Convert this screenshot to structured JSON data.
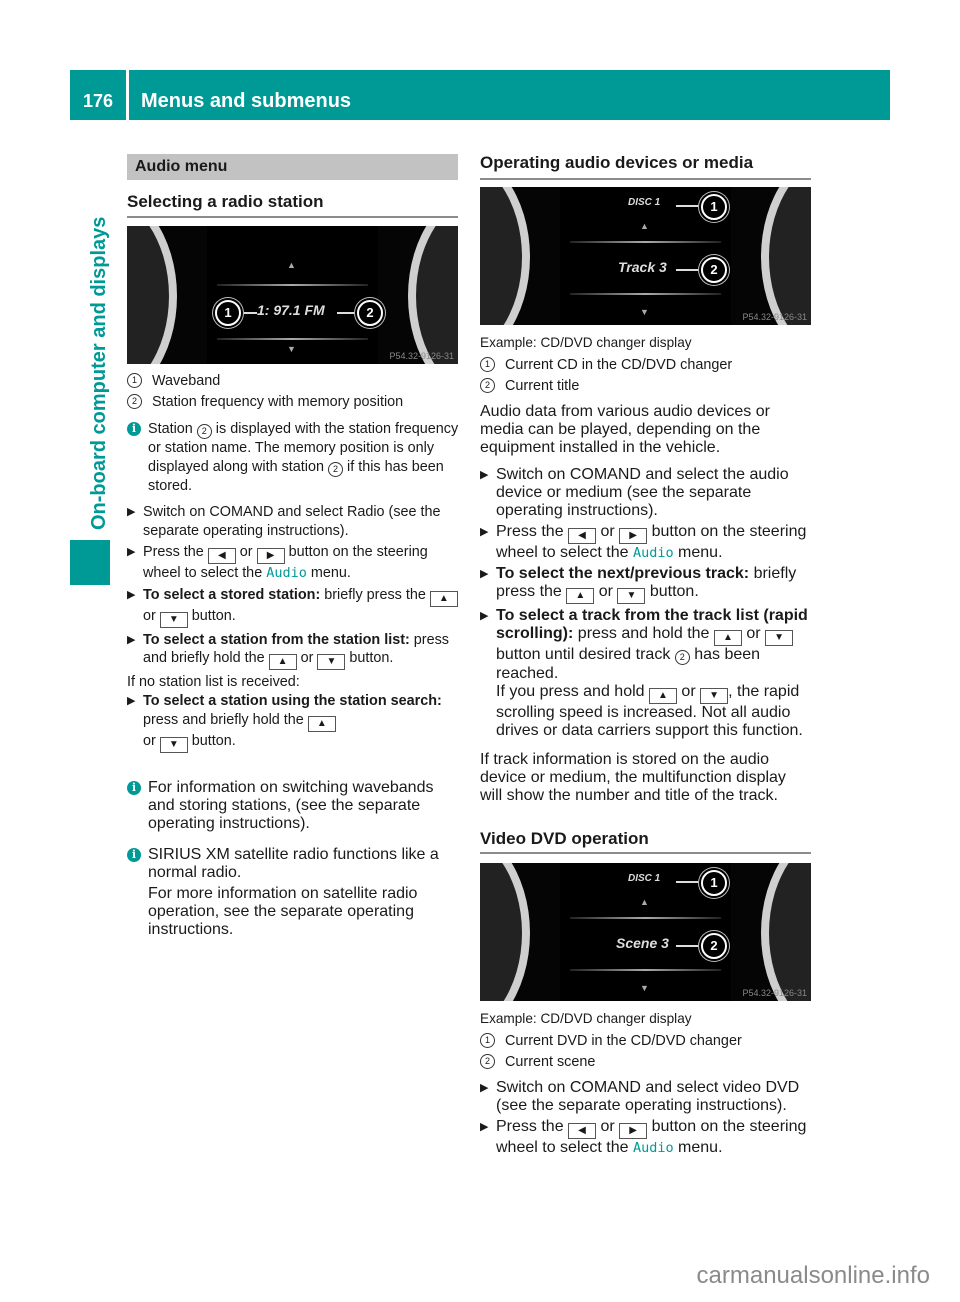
{
  "header": {
    "page_number": "176",
    "title": "Menus and submenus",
    "side_tab": "On-board computer and displays",
    "accent_color": "#009a96"
  },
  "left": {
    "section_bar": "Audio menu",
    "heading": "Selecting a radio station",
    "figure": {
      "display_text": "1: 97.1 FM",
      "callout_1": "1",
      "callout_2": "2",
      "image_code": "P54.32-9126-31"
    },
    "legend": [
      {
        "num": "1",
        "text": "Waveband"
      },
      {
        "num": "2",
        "text": "Station frequency with memory position"
      }
    ],
    "info1": {
      "pre": "Station ",
      "num": "2",
      "mid": " is displayed with the station frequency or station name. The memory position is only displayed along with station ",
      "num2": "2",
      "post": " if this has been stored."
    },
    "steps": [
      {
        "text": "Switch on COMAND and select Radio (see the separate operating instructions)."
      },
      {
        "pre": "Press the ",
        "key1": "◀",
        "or": " or ",
        "key2": "▶",
        "mid": " button on the steering wheel to select the ",
        "code": "Audio",
        "post": " menu."
      },
      {
        "bold": "To select a stored station:",
        "pre": " briefly press the ",
        "key1": "▲",
        "or": " or ",
        "key2": "▼",
        "post": " button."
      },
      {
        "bold": "To select a station from the station list:",
        "pre": " press and briefly hold the ",
        "key1": "▲",
        "or": " or ",
        "key2": "▼",
        "post": " button."
      }
    ],
    "no_list_text": "If no station list is received:",
    "search_step": {
      "bold": "To select a station using the station search:",
      "pre": " press and briefly hold the ",
      "key1": "▲",
      "or": " or ",
      "key2": "▼",
      "post": " button."
    },
    "info2": "For information on switching wavebands and storing stations, (see the separate operating instructions).",
    "info3": "SIRIUS XM satellite radio functions like a normal radio.",
    "info3_more": "For more information on satellite radio operation, see the separate operating instructions."
  },
  "right": {
    "heading1": "Operating audio devices or media",
    "figure1": {
      "line1": "DISC 1",
      "line2": "Track 3",
      "callout_1": "1",
      "callout_2": "2",
      "image_code": "P54.32-9126-31"
    },
    "caption1": "Example: CD/DVD changer display",
    "legend1": [
      {
        "num": "1",
        "text": "Current CD in the CD/DVD changer"
      },
      {
        "num": "2",
        "text": "Current title"
      }
    ],
    "para1": "Audio data from various audio devices or media can be played, depending on the equipment installed in the vehicle.",
    "steps1": [
      {
        "text": "Switch on COMAND and select the audio device or medium (see the separate operating instructions)."
      },
      {
        "pre": "Press the ",
        "key1": "◀",
        "or": " or ",
        "key2": "▶",
        "mid": " button on the steering wheel to select the ",
        "code": "Audio",
        "post": " menu."
      },
      {
        "bold": "To select the next/previous track:",
        "pre": " briefly press the ",
        "key1": "▲",
        "or": " or ",
        "key2": "▼",
        "post": " button."
      },
      {
        "bold": "To select a track from the track list (rapid scrolling):",
        "pre": " press and hold the ",
        "key1": "▲",
        "or": " or ",
        "key2": "▼",
        "mid": " button until desired track ",
        "num": "2",
        "post": " has been reached."
      }
    ],
    "rapid_note": {
      "pre": "If you press and hold ",
      "key1": "▲",
      "or": " or ",
      "key2": "▼",
      "post": ", the rapid scrolling speed is increased. Not all audio drives or data carriers support this function."
    },
    "para2": "If track information is stored on the audio device or medium, the multifunction display will show the number and title of the track.",
    "heading2": "Video DVD operation",
    "figure2": {
      "line1": "DISC 1",
      "line2": "Scene 3",
      "callout_1": "1",
      "callout_2": "2",
      "image_code": "P54.32-9126-31"
    },
    "caption2": "Example: CD/DVD changer display",
    "legend2": [
      {
        "num": "1",
        "text": "Current DVD in the CD/DVD changer"
      },
      {
        "num": "2",
        "text": "Current scene"
      }
    ],
    "steps2": [
      {
        "text": "Switch on COMAND and select video DVD (see the separate operating instructions)."
      },
      {
        "pre": "Press the ",
        "key1": "◀",
        "or": " or ",
        "key2": "▶",
        "mid": " button on the steering wheel to select the ",
        "code": "Audio",
        "post": " menu."
      }
    ]
  },
  "footer": {
    "watermark": "carmanualsonline.info"
  },
  "icons": {
    "step_marker": "▶",
    "info": "i"
  }
}
